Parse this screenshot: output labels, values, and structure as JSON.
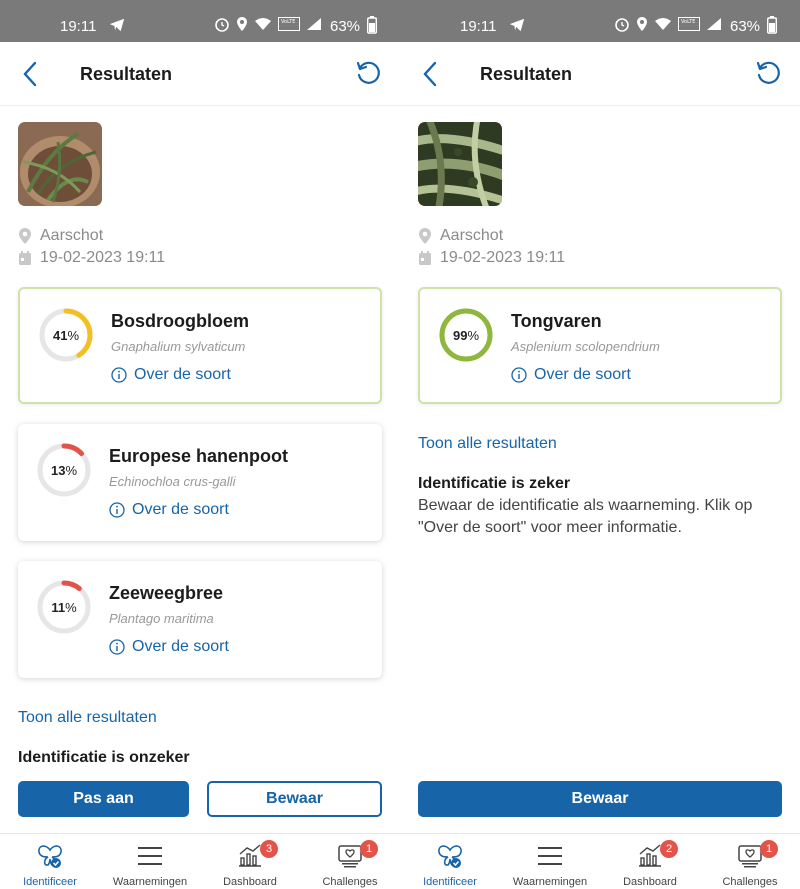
{
  "colors": {
    "accent": "#1764a8",
    "yellow": "#f3c024",
    "red": "#e2544a",
    "green": "#8fb73e",
    "ring_bg": "#e6e6e6",
    "statusbar": "#7a7a7a"
  },
  "statusbar": {
    "time": "19:11",
    "battery": "63%"
  },
  "left": {
    "header": {
      "title": "Resultaten"
    },
    "location": "Aarschot",
    "datetime": "19-02-2023 19:11",
    "results": [
      {
        "percent_num": "41",
        "percent_sign": "%",
        "value": 41,
        "color": "yellow",
        "name": "Bosdroogbloem",
        "latin": "Gnaphalium sylvaticum",
        "about": "Over de soort"
      },
      {
        "percent_num": "13",
        "percent_sign": "%",
        "value": 13,
        "color": "red",
        "name": "Europese hanenpoot",
        "latin": "Echinochloa crus-galli",
        "about": "Over de soort"
      },
      {
        "percent_num": "11",
        "percent_sign": "%",
        "value": 11,
        "color": "red",
        "name": "Zeeweegbree",
        "latin": "Plantago maritima",
        "about": "Over de soort"
      }
    ],
    "show_all": "Toon alle resultaten",
    "status_title": "Identificatie is onzeker",
    "buttons": {
      "adjust": "Pas aan",
      "save": "Bewaar"
    }
  },
  "right": {
    "header": {
      "title": "Resultaten"
    },
    "location": "Aarschot",
    "datetime": "19-02-2023 19:11",
    "results": [
      {
        "percent_num": "99",
        "percent_sign": "%",
        "value": 99,
        "color": "green",
        "name": "Tongvaren",
        "latin": "Asplenium scolopendrium",
        "about": "Over de soort"
      }
    ],
    "show_all": "Toon alle resultaten",
    "status_title": "Identificatie is zeker",
    "status_text_line1": "Bewaar de identificatie als waarneming. Klik op",
    "status_text_line2": "\"Over de soort\" voor meer informatie.",
    "buttons": {
      "save": "Bewaar"
    }
  },
  "nav": {
    "items": [
      {
        "label": "Identificeer",
        "icon": "butterfly-icon",
        "active": true
      },
      {
        "label": "Waarnemingen",
        "icon": "list-icon",
        "active": false
      },
      {
        "label": "Dashboard",
        "icon": "chart-icon",
        "active": false
      },
      {
        "label": "Challenges",
        "icon": "challenge-icon",
        "active": false
      }
    ],
    "left_badges": {
      "dashboard": "3",
      "challenges": "1"
    },
    "right_badges": {
      "dashboard": "2",
      "challenges": "1"
    }
  }
}
